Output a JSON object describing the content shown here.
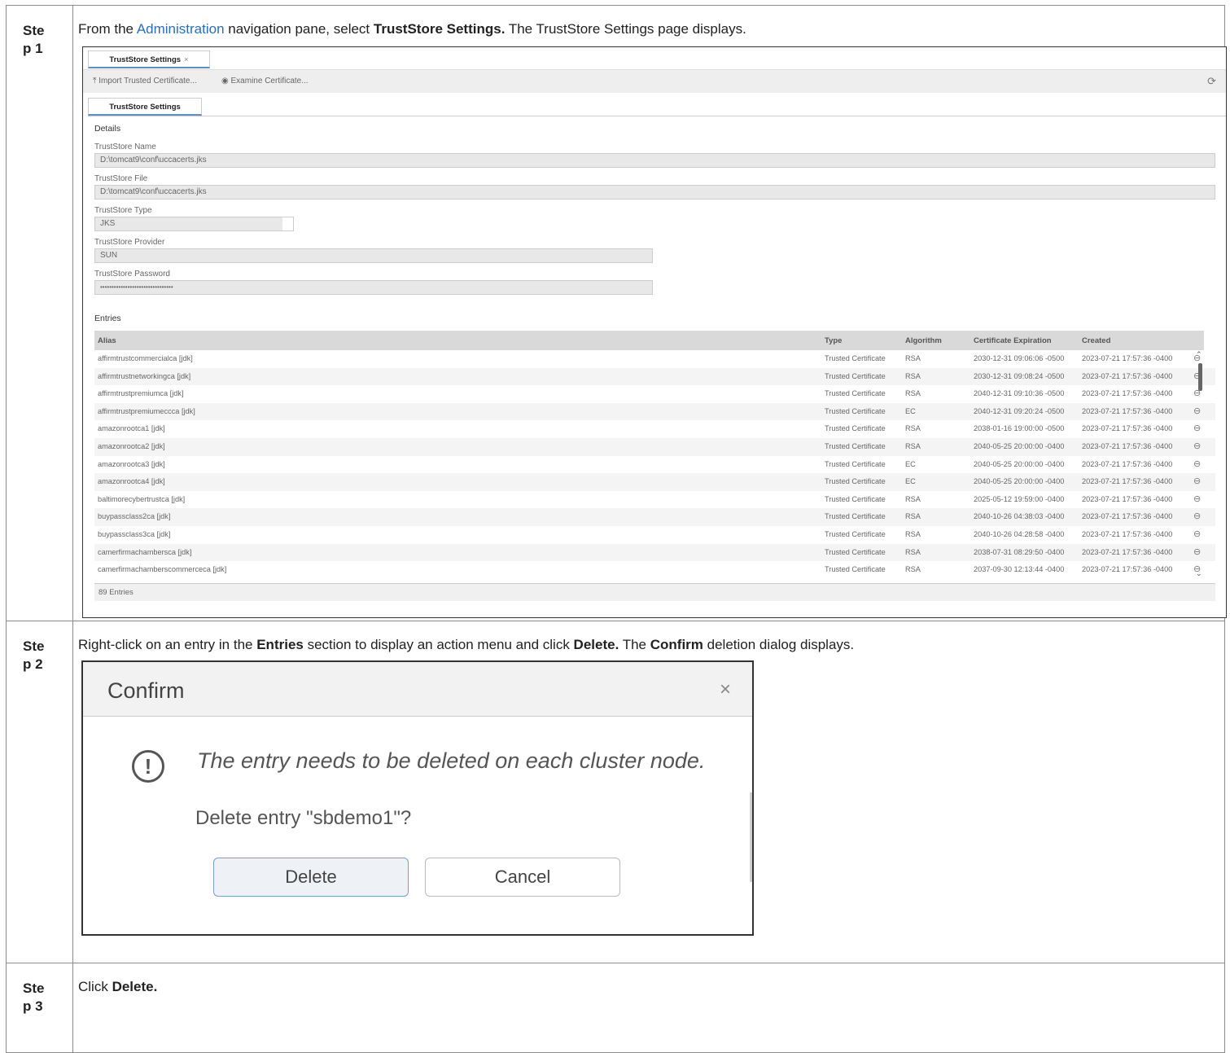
{
  "steps": [
    {
      "label": "Step 1",
      "text_parts": {
        "pre": "From the ",
        "link": "Administration",
        "mid": " navigation pane, select ",
        "bold": "TrustStore Settings.",
        "post": " The TrustStore Settings page displays."
      }
    },
    {
      "label": "Step 2",
      "text_parts": {
        "pre": "Right-click on an entry in the ",
        "bold1": "Entries",
        "mid1": " section to display an action menu and click ",
        "bold2": "Delete.",
        "mid2": " The ",
        "bold3": "Confirm",
        "post": " deletion dialog displays."
      }
    },
    {
      "label": "Step 3",
      "text_parts": {
        "pre": "Click ",
        "bold": "Delete."
      }
    }
  ],
  "truststore": {
    "tab_label": "TrustStore Settings",
    "tab_close": "×",
    "toolbar": {
      "import_label": "Import Trusted Certificate...",
      "examine_label": "Examine Certificate..."
    },
    "subtab_label": "TrustStore Settings",
    "details_heading": "Details",
    "fields": {
      "name_label": "TrustStore Name",
      "name_value": "D:\\tomcat9\\conf\\uccacerts.jks",
      "file_label": "TrustStore File",
      "file_value": "D:\\tomcat9\\conf\\uccacerts.jks",
      "type_label": "TrustStore Type",
      "type_value": "JKS",
      "provider_label": "TrustStore Provider",
      "provider_value": "SUN",
      "password_label": "TrustStore Password",
      "password_value": "••••••••••••••••••••••••••••••••"
    },
    "entries_heading": "Entries",
    "columns": {
      "alias": "Alias",
      "type": "Type",
      "algorithm": "Algorithm",
      "expiration": "Certificate Expiration",
      "created": "Created"
    },
    "rows": [
      {
        "alias": "affirmtrustcommercialca [jdk]",
        "type": "Trusted Certificate",
        "algorithm": "RSA",
        "expiration": "2030-12-31 09:06:06 -0500",
        "created": "2023-07-21 17:57:36 -0400"
      },
      {
        "alias": "affirmtrustnetworkingca [jdk]",
        "type": "Trusted Certificate",
        "algorithm": "RSA",
        "expiration": "2030-12-31 09:08:24 -0500",
        "created": "2023-07-21 17:57:36 -0400"
      },
      {
        "alias": "affirmtrustpremiumca [jdk]",
        "type": "Trusted Certificate",
        "algorithm": "RSA",
        "expiration": "2040-12-31 09:10:36 -0500",
        "created": "2023-07-21 17:57:36 -0400"
      },
      {
        "alias": "affirmtrustpremiumeccca [jdk]",
        "type": "Trusted Certificate",
        "algorithm": "EC",
        "expiration": "2040-12-31 09:20:24 -0500",
        "created": "2023-07-21 17:57:36 -0400"
      },
      {
        "alias": "amazonrootca1 [jdk]",
        "type": "Trusted Certificate",
        "algorithm": "RSA",
        "expiration": "2038-01-16 19:00:00 -0500",
        "created": "2023-07-21 17:57:36 -0400"
      },
      {
        "alias": "amazonrootca2 [jdk]",
        "type": "Trusted Certificate",
        "algorithm": "RSA",
        "expiration": "2040-05-25 20:00:00 -0400",
        "created": "2023-07-21 17:57:36 -0400"
      },
      {
        "alias": "amazonrootca3 [jdk]",
        "type": "Trusted Certificate",
        "algorithm": "EC",
        "expiration": "2040-05-25 20:00:00 -0400",
        "created": "2023-07-21 17:57:36 -0400"
      },
      {
        "alias": "amazonrootca4 [jdk]",
        "type": "Trusted Certificate",
        "algorithm": "EC",
        "expiration": "2040-05-25 20:00:00 -0400",
        "created": "2023-07-21 17:57:36 -0400"
      },
      {
        "alias": "baltimorecybertrustca [jdk]",
        "type": "Trusted Certificate",
        "algorithm": "RSA",
        "expiration": "2025-05-12 19:59:00 -0400",
        "created": "2023-07-21 17:57:36 -0400"
      },
      {
        "alias": "buypassclass2ca [jdk]",
        "type": "Trusted Certificate",
        "algorithm": "RSA",
        "expiration": "2040-10-26 04:38:03 -0400",
        "created": "2023-07-21 17:57:36 -0400"
      },
      {
        "alias": "buypassclass3ca [jdk]",
        "type": "Trusted Certificate",
        "algorithm": "RSA",
        "expiration": "2040-10-26 04:28:58 -0400",
        "created": "2023-07-21 17:57:36 -0400"
      },
      {
        "alias": "camerfirmachambersca [jdk]",
        "type": "Trusted Certificate",
        "algorithm": "RSA",
        "expiration": "2038-07-31 08:29:50 -0400",
        "created": "2023-07-21 17:57:36 -0400"
      },
      {
        "alias": "camerfirmachamberscommerceca [jdk]",
        "type": "Trusted Certificate",
        "algorithm": "RSA",
        "expiration": "2037-09-30 12:13:44 -0400",
        "created": "2023-07-21 17:57:36 -0400"
      }
    ],
    "footer": "89 Entries"
  },
  "dialog": {
    "title": "Confirm",
    "close": "×",
    "message": "The entry needs to be deleted on each cluster node.",
    "question": "Delete entry \"sbdemo1\"?",
    "delete_label": "Delete",
    "cancel_label": "Cancel"
  },
  "colors": {
    "link": "#2a6ebb",
    "border": "#8c8c8c",
    "accent": "#5b8fc9"
  }
}
